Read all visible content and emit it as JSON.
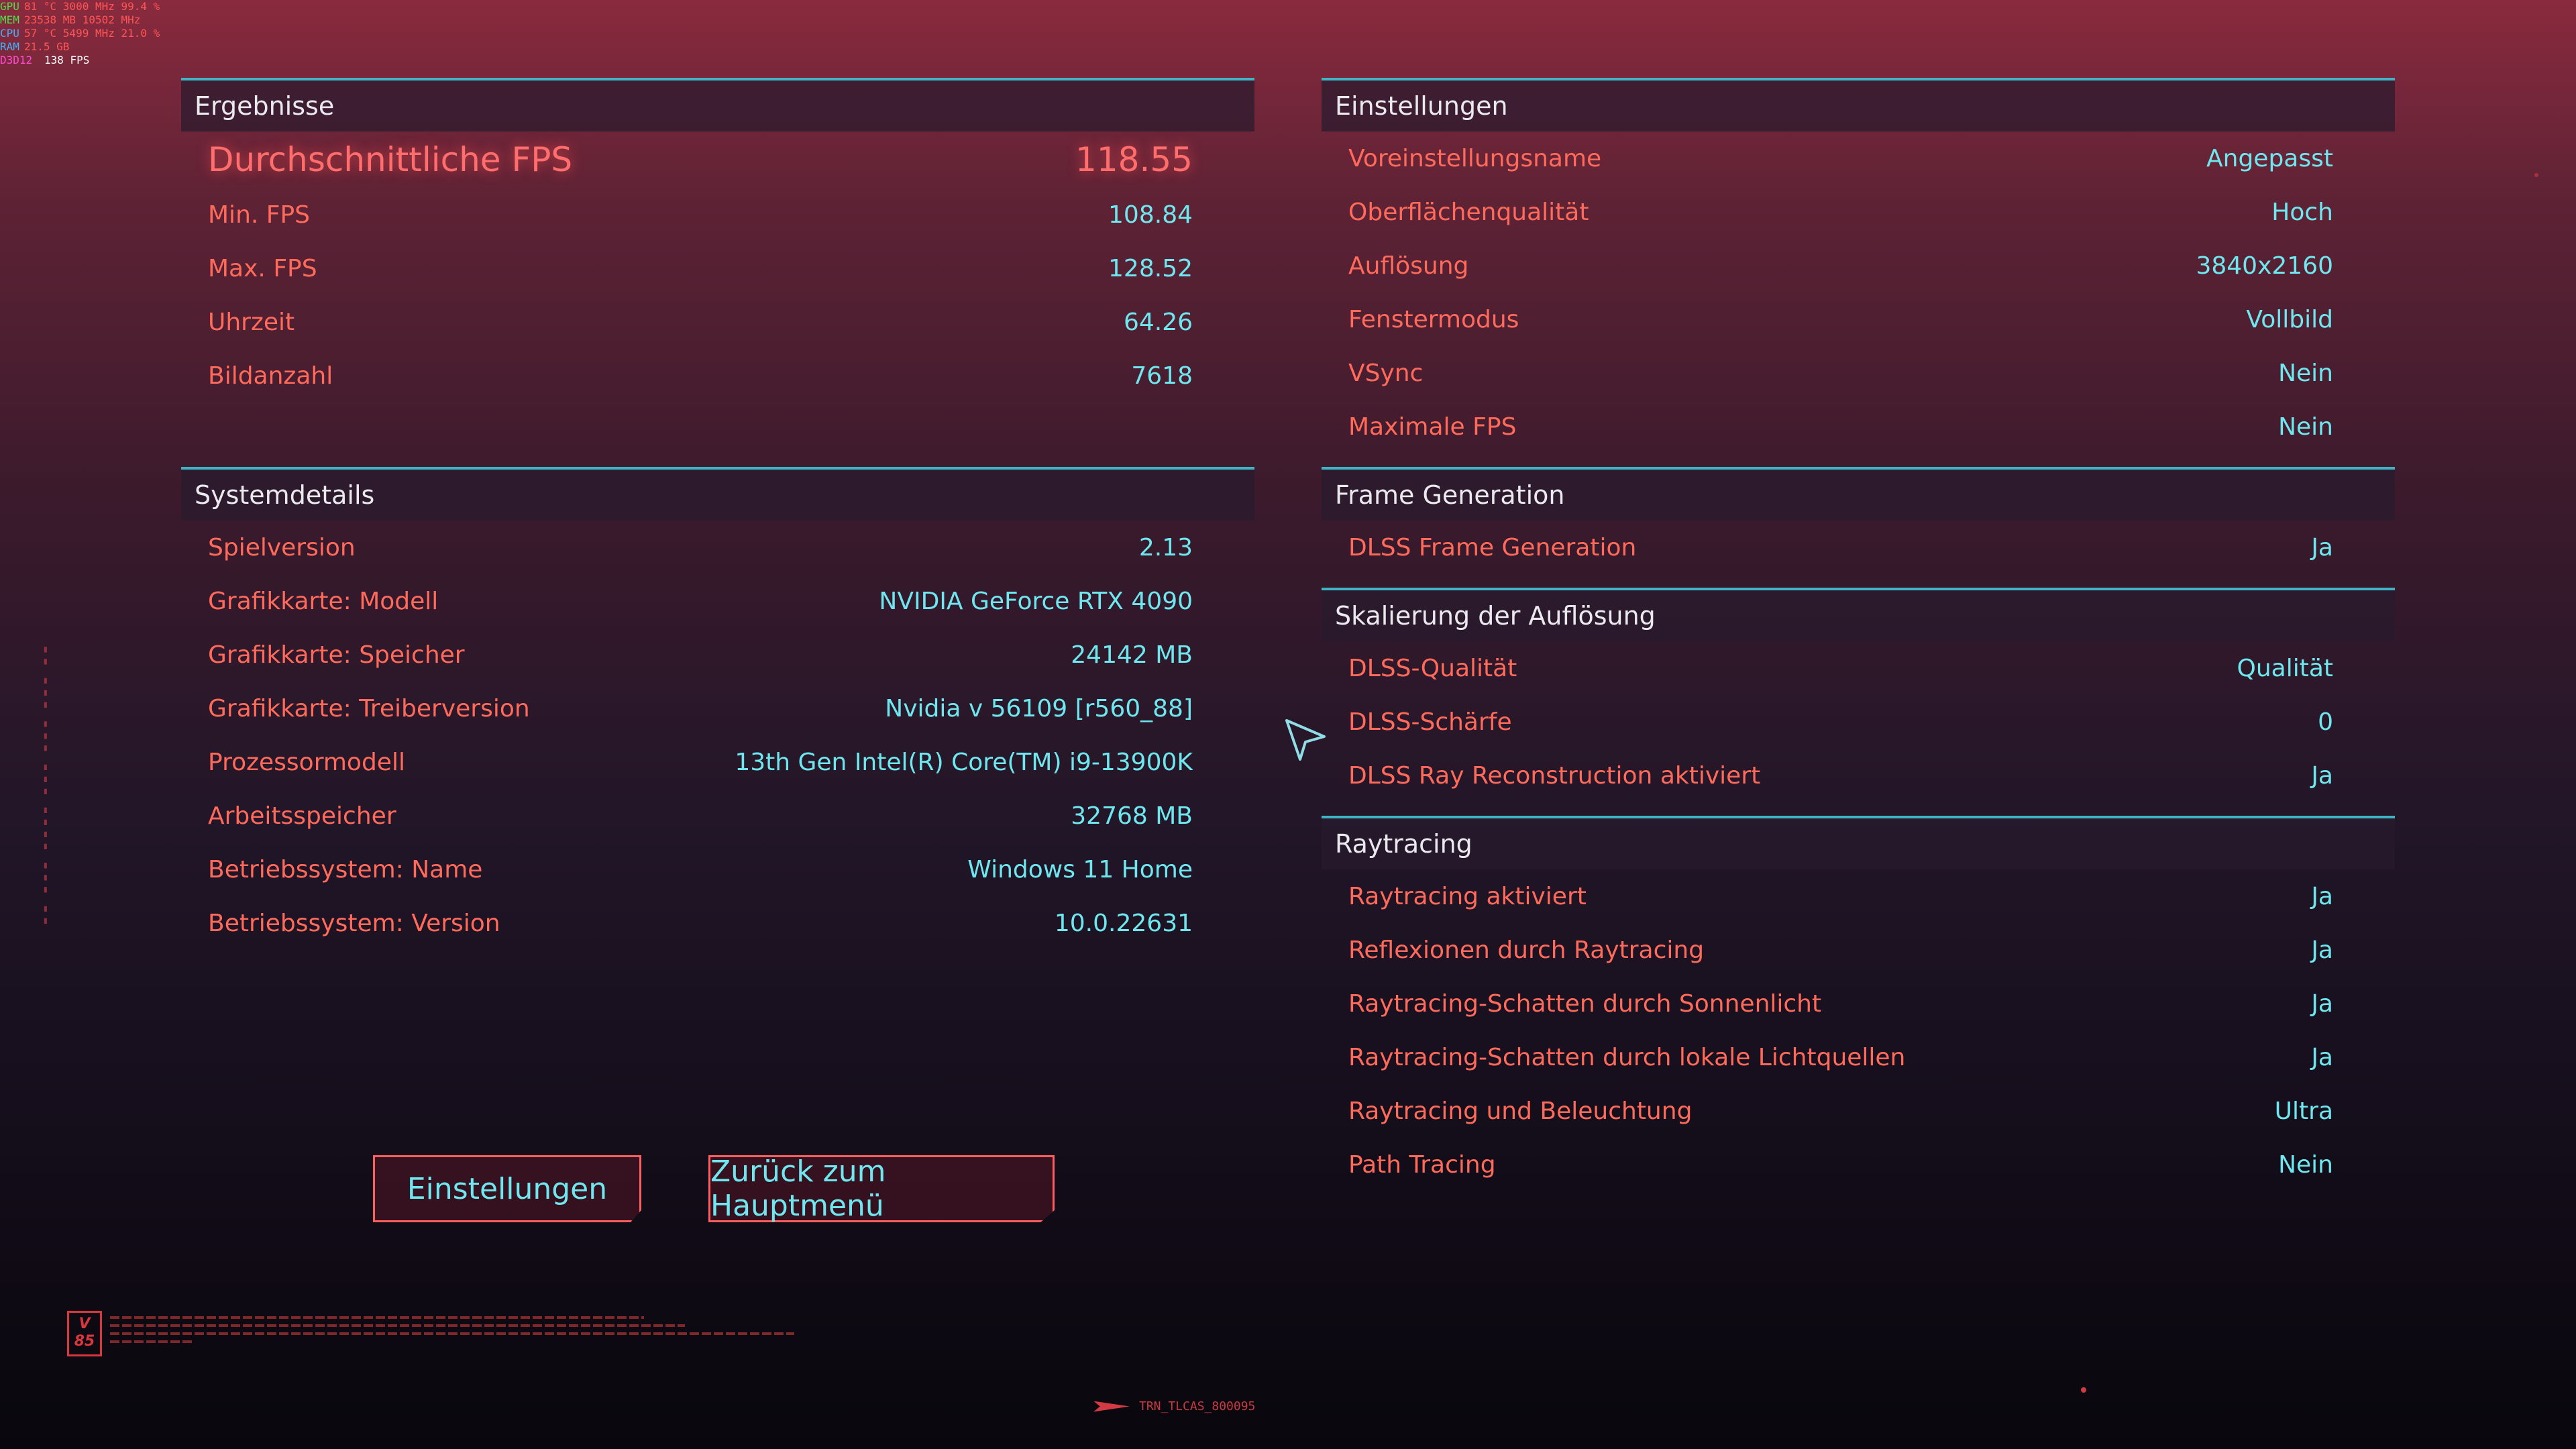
{
  "hud": [
    {
      "label": "GPU",
      "color": "#4be04b",
      "value": "81 °C  3000 MHz  99.4 %"
    },
    {
      "label": "MEM",
      "color": "#4be04b",
      "value": "23538 MB  10502 MHz"
    },
    {
      "label": "CPU",
      "color": "#3db4ff",
      "value": "57 °C  5499 MHz  21.0 %"
    },
    {
      "label": "RAM",
      "color": "#3db4ff",
      "value": "21.5 GB"
    },
    {
      "label": "D3D12",
      "color": "#ff4dd2",
      "value": "138 FPS"
    }
  ],
  "results": {
    "title": "Ergebnisse",
    "highlight": {
      "label": "Durchschnittliche FPS",
      "value": "118.55"
    },
    "rows": [
      {
        "label": "Min. FPS",
        "value": "108.84"
      },
      {
        "label": "Max. FPS",
        "value": "128.52"
      },
      {
        "label": "Uhrzeit",
        "value": "64.26"
      },
      {
        "label": "Bildanzahl",
        "value": "7618"
      }
    ]
  },
  "system": {
    "title": "Systemdetails",
    "rows": [
      {
        "label": "Spielversion",
        "value": "2.13"
      },
      {
        "label": "Grafikkarte: Modell",
        "value": "NVIDIA GeForce RTX 4090"
      },
      {
        "label": "Grafikkarte: Speicher",
        "value": "24142 MB"
      },
      {
        "label": "Grafikkarte: Treiberversion",
        "value": "Nvidia v 56109 [r560_88]"
      },
      {
        "label": "Prozessormodell",
        "value": "13th Gen Intel(R) Core(TM) i9-13900K"
      },
      {
        "label": "Arbeitsspeicher",
        "value": "32768 MB"
      },
      {
        "label": "Betriebssystem: Name",
        "value": "Windows 11 Home"
      },
      {
        "label": "Betriebssystem: Version",
        "value": "10.0.22631"
      }
    ]
  },
  "settings": {
    "title": "Einstellungen",
    "rows": [
      {
        "label": "Voreinstellungsname",
        "value": "Angepasst"
      },
      {
        "label": "Oberflächenqualität",
        "value": "Hoch"
      },
      {
        "label": "Auflösung",
        "value": "3840x2160"
      },
      {
        "label": "Fenstermodus",
        "value": "Vollbild"
      },
      {
        "label": "VSync",
        "value": "Nein"
      },
      {
        "label": "Maximale FPS",
        "value": "Nein"
      }
    ]
  },
  "frame_generation": {
    "title": "Frame Generation",
    "rows": [
      {
        "label": "DLSS Frame Generation",
        "value": "Ja"
      }
    ]
  },
  "scaling": {
    "title": "Skalierung der Auflösung",
    "rows": [
      {
        "label": "DLSS-Qualität",
        "value": "Qualität"
      },
      {
        "label": "DLSS-Schärfe",
        "value": "0"
      },
      {
        "label": "DLSS Ray Reconstruction aktiviert",
        "value": "Ja"
      }
    ]
  },
  "raytracing": {
    "title": "Raytracing",
    "rows": [
      {
        "label": "Raytracing aktiviert",
        "value": "Ja"
      },
      {
        "label": "Reflexionen durch Raytracing",
        "value": "Ja"
      },
      {
        "label": "Raytracing-Schatten durch Sonnenlicht",
        "value": "Ja"
      },
      {
        "label": "Raytracing-Schatten durch lokale Lichtquellen",
        "value": "Ja"
      },
      {
        "label": "Raytracing und Beleuchtung",
        "value": "Ultra"
      },
      {
        "label": "Path Tracing",
        "value": "Nein"
      }
    ]
  },
  "buttons": {
    "settings_label": "Einstellungen",
    "back_label": "Zurück zum Hauptmenü"
  },
  "logo": {
    "line1": "V",
    "line2": "85"
  },
  "build_id": "TRN_TLCAS_800095",
  "icons": {
    "cursor": "cursor-arrow-icon",
    "logo": "version-logo-icon",
    "build_arrow": "arrow-right-icon"
  },
  "colors": {
    "label": "#ff6a5b",
    "value": "#6fe7ef",
    "accent_line": "#3fb4c4",
    "button_border": "#ff5e5e"
  }
}
